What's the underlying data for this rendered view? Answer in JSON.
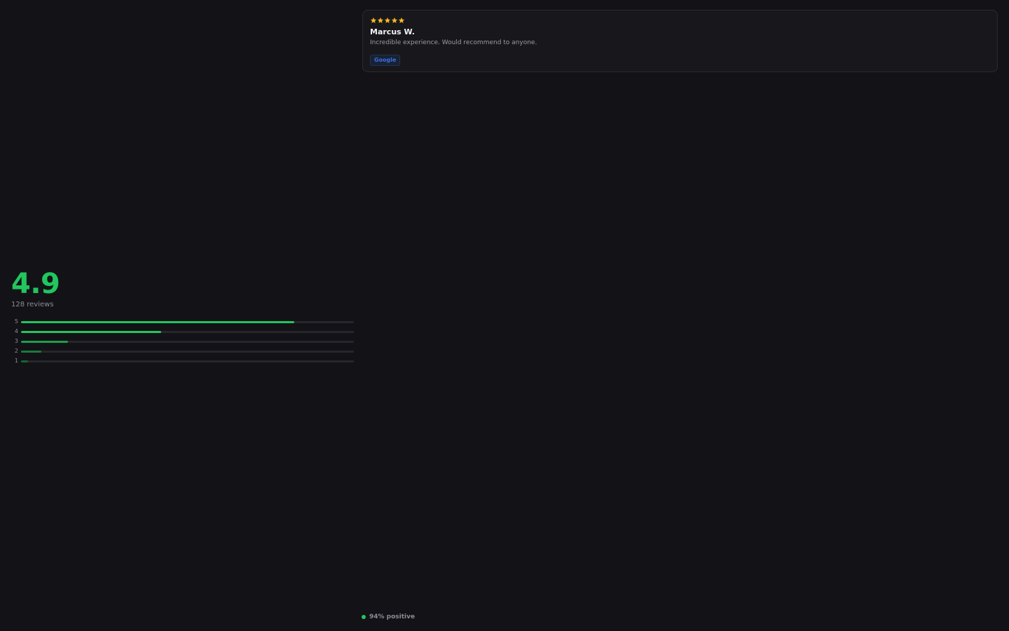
{
  "summary": {
    "score": "4.9",
    "review_count": "128 reviews",
    "distribution": [
      {
        "label": "5",
        "fraction": 0.82,
        "color": "#22c55e"
      },
      {
        "label": "4",
        "fraction": 0.42,
        "color": "#22c55e"
      },
      {
        "label": "3",
        "fraction": 0.14,
        "color": "#1e9e4d"
      },
      {
        "label": "2",
        "fraction": 0.06,
        "color": "#197a3d"
      },
      {
        "label": "1",
        "fraction": 0.02,
        "color": "#16632f"
      }
    ]
  },
  "review": {
    "rating": 5,
    "reviewer": "Marcus W.",
    "text": "Incredible experience. Would recommend to anyone.",
    "source": "Google",
    "star_color": "#f5b820"
  },
  "footer": {
    "positive": "94% positive",
    "dot_color": "#22c55e"
  }
}
